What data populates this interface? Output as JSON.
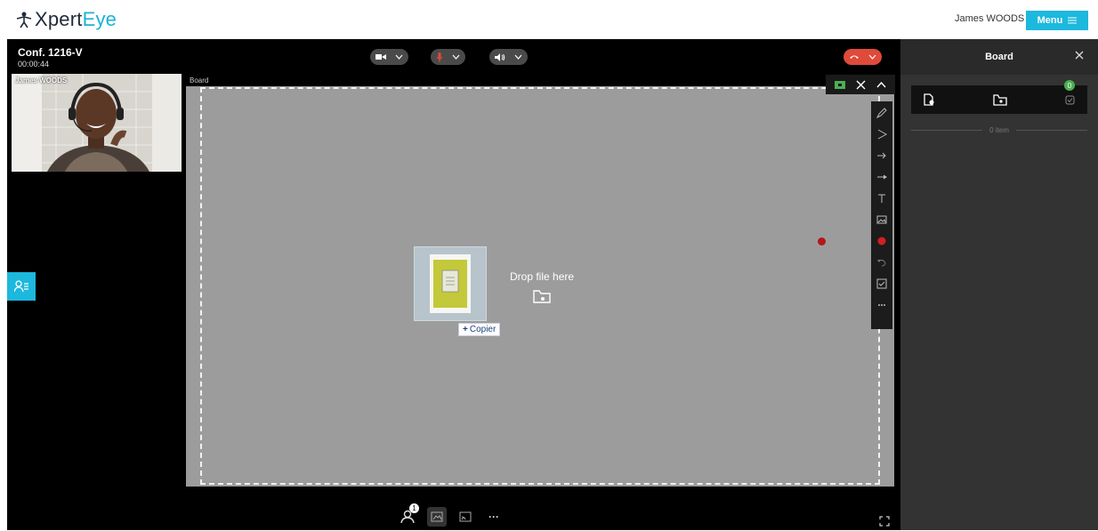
{
  "header": {
    "logo_prefix": "Xpert",
    "logo_accent": "Eye",
    "user_name": "James WOODS",
    "menu_label": "Menu"
  },
  "conference": {
    "title": "Conf. 1216-V",
    "timer": "00:00:44",
    "participant_label": "James WOODS",
    "board_label": "Board"
  },
  "board": {
    "drop_text": "Drop file here",
    "copier_label": "Copier"
  },
  "panel": {
    "title": "Board",
    "badge_count": "0",
    "item_count": "0 item"
  },
  "bottom": {
    "badge": "1",
    "more": "···"
  },
  "colors": {
    "accent": "#1cb8dd",
    "hangup": "#e04a3a",
    "badge_green": "#4caf50",
    "board_bg": "#9c9c9c"
  }
}
